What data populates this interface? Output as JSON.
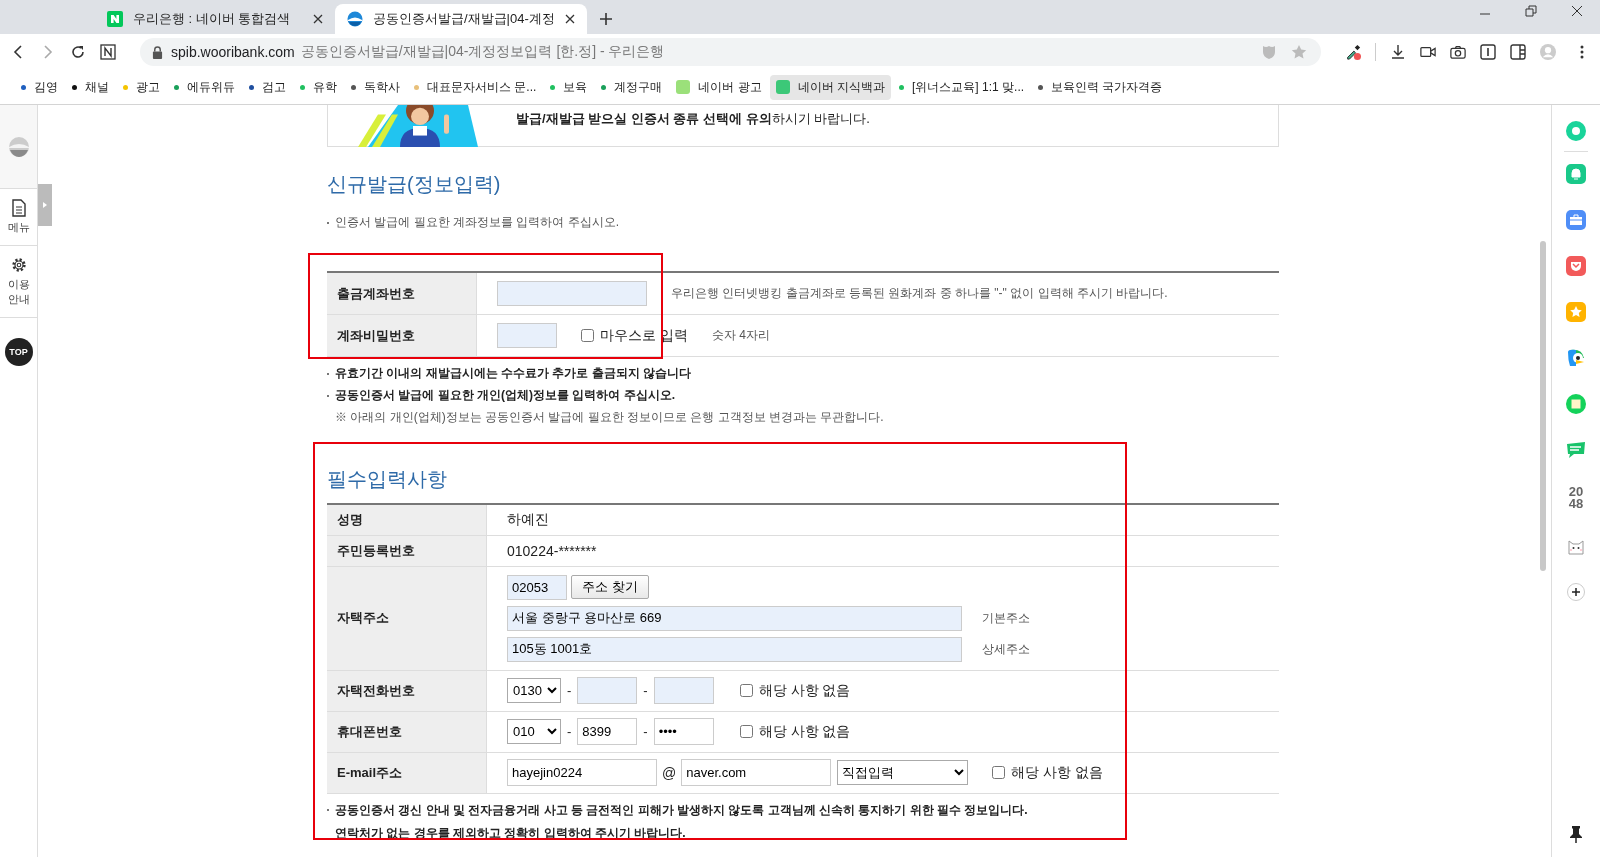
{
  "browser": {
    "tabs": [
      {
        "title": "우리은행 : 네이버 통합검색",
        "selected": false
      },
      {
        "title": "공동인증서발급/재발급|04-계정",
        "selected": true
      }
    ],
    "address": {
      "domain": "spib.wooribank.com",
      "title": "공동인증서발급/재발급|04-계정정보입력 [한.정] - 우리은행"
    },
    "bookmarks": [
      {
        "label": "김영",
        "kind": "dot",
        "color": "#1f5fbf",
        "hovered": false
      },
      {
        "label": "채널",
        "kind": "dot",
        "color": "#111111",
        "hovered": false
      },
      {
        "label": "광고",
        "kind": "dot",
        "color": "#f5c400",
        "hovered": false
      },
      {
        "label": "에듀위듀",
        "kind": "dot",
        "color": "#1aa05a",
        "hovered": false
      },
      {
        "label": "검고",
        "kind": "dot",
        "color": "#1f4f9f",
        "hovered": false
      },
      {
        "label": "유학",
        "kind": "dot",
        "color": "#20c060",
        "hovered": false
      },
      {
        "label": "독학사",
        "kind": "dot",
        "color": "#555555",
        "hovered": false
      },
      {
        "label": "대표문자서비스 문...",
        "kind": "dot",
        "color": "#e8c07a",
        "hovered": false
      },
      {
        "label": "보육",
        "kind": "dot",
        "color": "#20c060",
        "hovered": false
      },
      {
        "label": "계정구매",
        "kind": "dot",
        "color": "#1aa05a",
        "hovered": false
      },
      {
        "label": "네이버 광고",
        "kind": "square",
        "color": "#9be07a",
        "hovered": false
      },
      {
        "label": "네이버 지식백과",
        "kind": "square",
        "color": "#3cc878",
        "hovered": true
      },
      {
        "label": "[위너스교육] 1:1 맞...",
        "kind": "dot",
        "color": "#20c060",
        "hovered": false
      },
      {
        "label": "보육인력 국가자격증",
        "kind": "dot",
        "color": "#555555",
        "hovered": false
      }
    ]
  },
  "left_sidebar": {
    "items": [
      {
        "label": "메뉴",
        "kind": "document"
      },
      {
        "label": "이용 안내",
        "kind": "gear"
      }
    ],
    "top_button": "TOP"
  },
  "right_sidebar": {
    "game_label": "2048"
  },
  "banner": {
    "text": "**발급/재발급 받으실 인증서 종류 선택에 유의**하시기 바랍니다."
  },
  "account_section": {
    "title": "신규발급(정보입력)",
    "note": "인증서 발급에 필요한 계좌정보를 입력하여 주십시오.",
    "highlighted": true,
    "rows": [
      {
        "label": "출금계좌번호",
        "kind": "account",
        "hint": "우리은행 인터넷뱅킹 출금계좌로 등록된 원화계좌 중 하나를 \"-\" 없이 입력해 주시기 바랍니다."
      },
      {
        "label": "계좌비밀번호",
        "kind": "password",
        "checkbox": {
          "label": "마우스로 입력",
          "checked": false
        },
        "hint": "숫자 4자리"
      }
    ]
  },
  "notes": [
    {
      "text": "유효기간 이내의 재발급시에는 수수료가 추가로 출금되지 않습니다",
      "kind": "bold"
    },
    {
      "text": "공동인증서 발급에 필요한 개인(업체)정보를 입력하여 주십시오.",
      "kind": "bold"
    },
    {
      "text": "※ 아래의 개인(업체)정보는 공동인증서 발급에 필요한 정보이므로 은행 고객정보 변경과는 무관합니다.",
      "kind": "sub"
    }
  ],
  "required_section": {
    "title": "필수입력사항",
    "highlighted": true,
    "rows": [
      {
        "label": "성명",
        "kind": "text",
        "value": "하예진"
      },
      {
        "label": "주민등록번호",
        "kind": "text",
        "value": "010224-*******"
      },
      {
        "label": "자택주소",
        "kind": "address",
        "postcode": "02053",
        "button": "주소 찾기",
        "base": "서울 중랑구 용마산로 669",
        "base_label": "기본주소",
        "detail": "105동 1001호",
        "detail_label": "상세주소"
      },
      {
        "label": "자택전화번호",
        "kind": "phone",
        "prefix": "0130",
        "separator": "-",
        "none": {
          "label": "해당 사항 없음",
          "checked": false
        }
      },
      {
        "label": "휴대폰번호",
        "kind": "phone",
        "prefix": "010",
        "middle": "8399",
        "last": "••••",
        "separator": "-",
        "none": {
          "label": "해당 사항 없음",
          "checked": false
        }
      },
      {
        "label": "E-mail주소",
        "kind": "email",
        "user": "hayejin0224",
        "at": "@",
        "domain": "naver.com",
        "domain_select": "직접입력",
        "none": {
          "label": "해당 사항 없음",
          "checked": false
        }
      }
    ],
    "footer": [
      "공동인증서 갱신 안내 및 전자금융거래 사고 등 금전적인 피해가 발생하지 않도록 고객님께 신속히 통지하기 위한 필수 정보입니다.",
      "연락처가 없는 경우를 제외하고 정확히 입력하여 주시기 바랍니다."
    ]
  }
}
